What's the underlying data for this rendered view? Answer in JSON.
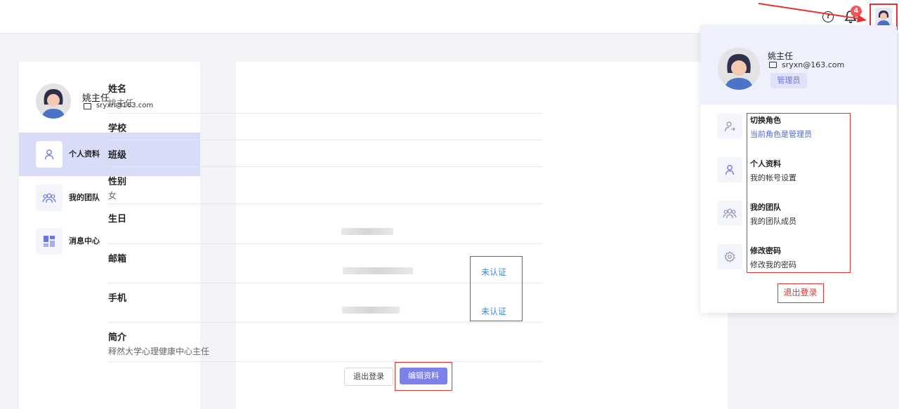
{
  "topbar": {
    "help_icon": "help-circle-icon",
    "bell_icon": "bell-icon",
    "notification_count": "4",
    "avatar_icon": "user-avatar"
  },
  "profile": {
    "name": "姚主任",
    "email": "sryxn@163.com"
  },
  "sidebar": {
    "items": [
      {
        "label": "个人资料",
        "icon": "user-icon",
        "active": true
      },
      {
        "label": "我的团队",
        "icon": "team-icon",
        "active": false
      },
      {
        "label": "消息中心",
        "icon": "message-grid-icon",
        "active": false
      }
    ]
  },
  "main": {
    "fields": {
      "name": {
        "label": "姓名",
        "value": "姚主任"
      },
      "school": {
        "label": "学校",
        "value": ""
      },
      "class": {
        "label": "班级",
        "value": ""
      },
      "gender": {
        "label": "性别",
        "value": "女"
      },
      "birthday": {
        "label": "生日"
      },
      "email": {
        "label": "邮箱",
        "status": "未认证"
      },
      "phone": {
        "label": "手机",
        "status": "未认证"
      },
      "bio": {
        "label": "简介",
        "value": "释然大学心理健康中心主任"
      }
    },
    "logout_button": "退出登录",
    "edit_button": "编辑资料"
  },
  "dropdown": {
    "name": "姚主任",
    "email": "sryxn@163.com",
    "role_badge": "管理员",
    "items": [
      {
        "title": "切换角色",
        "subtitle": "当前角色是管理员",
        "icon": "switch-role-icon"
      },
      {
        "title": "个人资料",
        "subtitle": "我的帐号设置",
        "icon": "user-icon"
      },
      {
        "title": "我的团队",
        "subtitle": "我的团队成员",
        "icon": "team-icon"
      },
      {
        "title": "修改密码",
        "subtitle": "修改我的密码",
        "icon": "gear-icon"
      }
    ],
    "logout_label": "退出登录"
  },
  "colors": {
    "accent": "#7b80ea",
    "active_nav_bg": "#d9dcf7",
    "link": "#2f8bf0",
    "annotation_red": "#e4332c",
    "badge_red": "#f2545b"
  }
}
